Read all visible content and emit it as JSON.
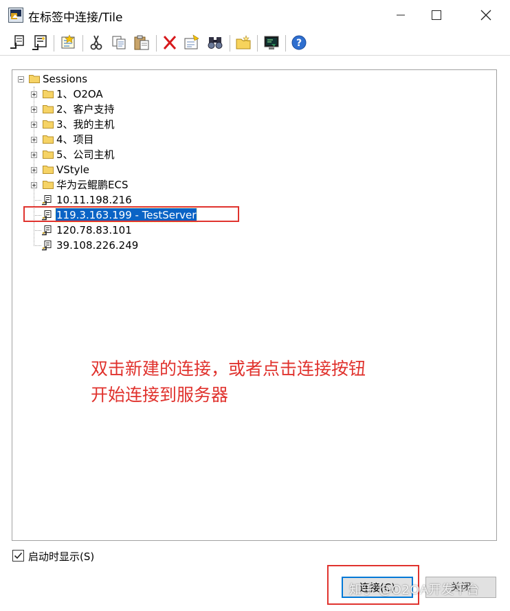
{
  "window": {
    "title": "在标签中连接/Tile"
  },
  "toolbar": {
    "icons": [
      "quick-connect-icon",
      "connect-icon",
      "new-session-icon",
      "cut-icon",
      "copy-icon",
      "paste-icon",
      "delete-icon",
      "properties-icon",
      "find-icon",
      "new-folder-icon",
      "desktop-shortcut-icon",
      "help-icon"
    ]
  },
  "tree": {
    "root": "Sessions",
    "folders": [
      "1、O2OA",
      "2、客户支持",
      "3、我的主机",
      "4、项目",
      "5、公司主机",
      "VStyle",
      "华为云鲲鹏ECS"
    ],
    "sessions": [
      "10.11.198.216",
      "119.3.163.199 - TestServer",
      "120.78.83.101",
      "39.108.226.249"
    ],
    "selected_index": 1
  },
  "annotation": {
    "line1": "双击新建的连接，或者点击连接按钮",
    "line2": "开始连接到服务器",
    "color": "#e0322d"
  },
  "footer": {
    "show_on_startup": "启动时显示(S)",
    "show_on_startup_checked": true,
    "connect_label": "连接(C)",
    "close_label": "关闭",
    "watermark": "知乎 @O2OA开发平台"
  },
  "colors": {
    "selection": "#0a63c5",
    "accent": "#0078d7",
    "annotation": "#e0322d"
  }
}
